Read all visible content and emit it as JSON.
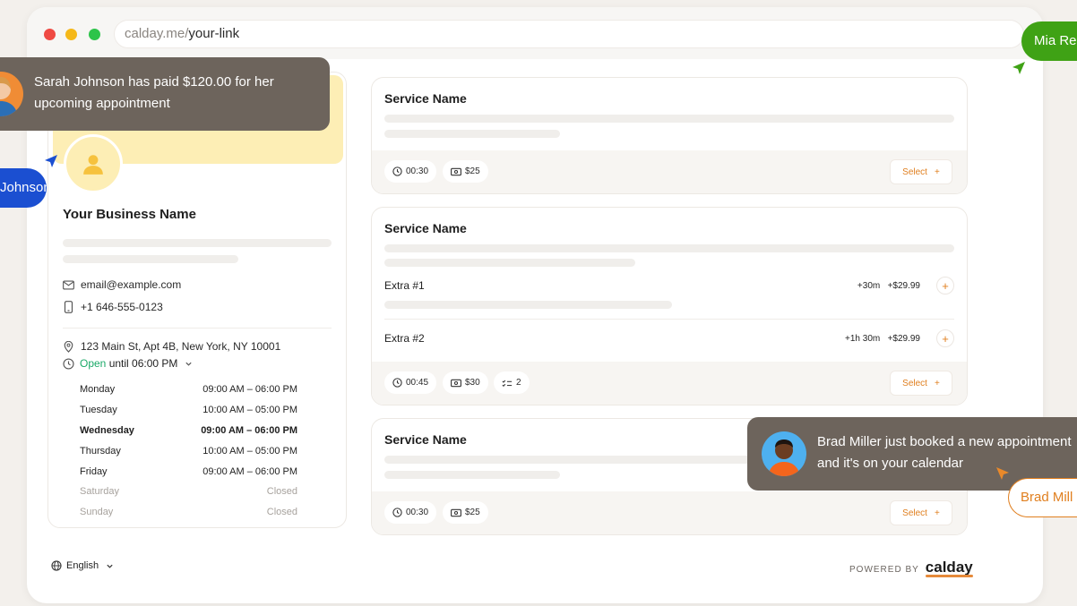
{
  "browser": {
    "url_host": "calday.me/",
    "url_path": "your-link"
  },
  "profile": {
    "business_name": "Your Business Name",
    "email": "email@example.com",
    "phone": "+1 646-555-0123",
    "address": "123 Main St, Apt 4B, New York, NY 10001",
    "open_status": "Open",
    "open_until": "until 06:00 PM",
    "hours": [
      {
        "day": "Monday",
        "time": "09:00 AM – 06:00 PM"
      },
      {
        "day": "Tuesday",
        "time": "10:00 AM – 05:00 PM"
      },
      {
        "day": "Wednesday",
        "time": "09:00 AM – 06:00 PM"
      },
      {
        "day": "Thursday",
        "time": "10:00 AM – 05:00 PM"
      },
      {
        "day": "Friday",
        "time": "09:00 AM – 06:00 PM"
      },
      {
        "day": "Saturday",
        "time": "Closed"
      },
      {
        "day": "Sunday",
        "time": "Closed"
      }
    ]
  },
  "services": [
    {
      "title": "Service Name",
      "duration": "00:30",
      "price": "$25",
      "select_label": "Select"
    },
    {
      "title": "Service Name",
      "duration": "00:45",
      "price": "$30",
      "extras_count": "2",
      "select_label": "Select",
      "extras": [
        {
          "name": "Extra #1",
          "time": "+30m",
          "price": "+$29.99"
        },
        {
          "name": "Extra #2",
          "time": "+1h 30m",
          "price": "+$29.99"
        }
      ]
    },
    {
      "title": "Service Name",
      "duration": "00:30",
      "price": "$25",
      "select_label": "Select"
    }
  ],
  "footer": {
    "language": "English",
    "powered_by": "POWERED BY",
    "brand": "calday"
  },
  "notifications": {
    "payment_line1": "Sarah Johnson has paid $120.00 for her",
    "payment_line2": "upcoming appointment",
    "booking_line1": "Brad Miller just booked a new appointment",
    "booking_line2": "and it's on your calendar"
  },
  "cursors": {
    "blue_label": "Johnson",
    "green_label": "Mia Re",
    "orange_label": "Brad Mill"
  },
  "colors": {
    "accent_orange": "#e07f1f",
    "open_green": "#1ba968",
    "cover_yellow": "#fdeeb5"
  }
}
